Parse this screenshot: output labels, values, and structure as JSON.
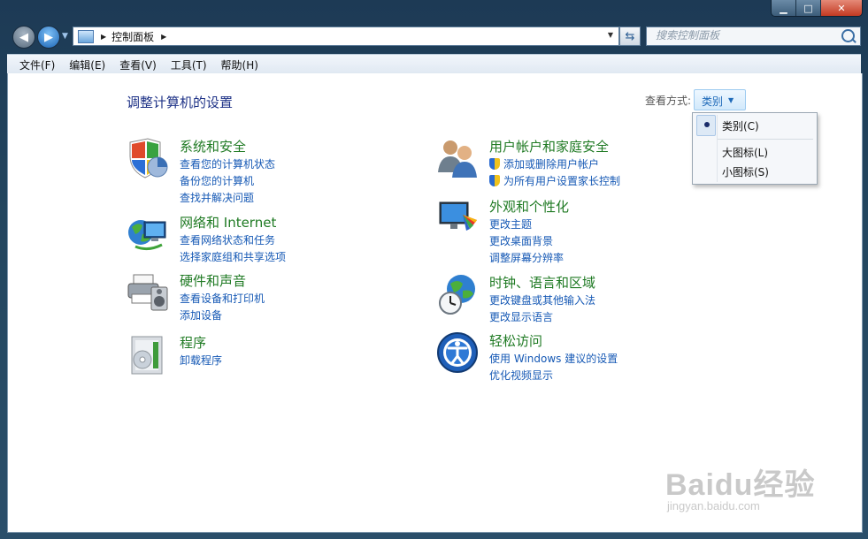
{
  "window": {
    "controls": [
      "minimize-icon",
      "maximize-icon",
      "close-icon"
    ]
  },
  "nav": {
    "address": {
      "crumb": "控制面板"
    },
    "search": {
      "placeholder": "搜索控制面板"
    }
  },
  "menubar": [
    "文件(F)",
    "编辑(E)",
    "查看(V)",
    "工具(T)",
    "帮助(H)"
  ],
  "main": {
    "title": "调整计算机的设置",
    "view_by_label": "查看方式:",
    "view_by_value": "类别",
    "view_menu": [
      "类别(C)",
      "大图标(L)",
      "小图标(S)"
    ]
  },
  "categories": {
    "system": {
      "title": "系统和安全",
      "links": [
        "查看您的计算机状态",
        "备份您的计算机",
        "查找并解决问题"
      ]
    },
    "network": {
      "title": "网络和 Internet",
      "links": [
        "查看网络状态和任务",
        "选择家庭组和共享选项"
      ]
    },
    "hardware": {
      "title": "硬件和声音",
      "links": [
        "查看设备和打印机",
        "添加设备"
      ]
    },
    "programs": {
      "title": "程序",
      "links": [
        "卸载程序"
      ]
    },
    "users": {
      "title": "用户帐户和家庭安全",
      "links": [
        "添加或删除用户帐户",
        "为所有用户设置家长控制"
      ]
    },
    "appearance": {
      "title": "外观和个性化",
      "links": [
        "更改主题",
        "更改桌面背景",
        "调整屏幕分辨率"
      ]
    },
    "clock": {
      "title": "时钟、语言和区域",
      "links": [
        "更改键盘或其他输入法",
        "更改显示语言"
      ]
    },
    "access": {
      "title": "轻松访问",
      "links": [
        "使用 Windows 建议的设置",
        "优化视频显示"
      ]
    }
  },
  "watermark": {
    "logo": "Baidu经验",
    "url": "jingyan.baidu.com"
  }
}
